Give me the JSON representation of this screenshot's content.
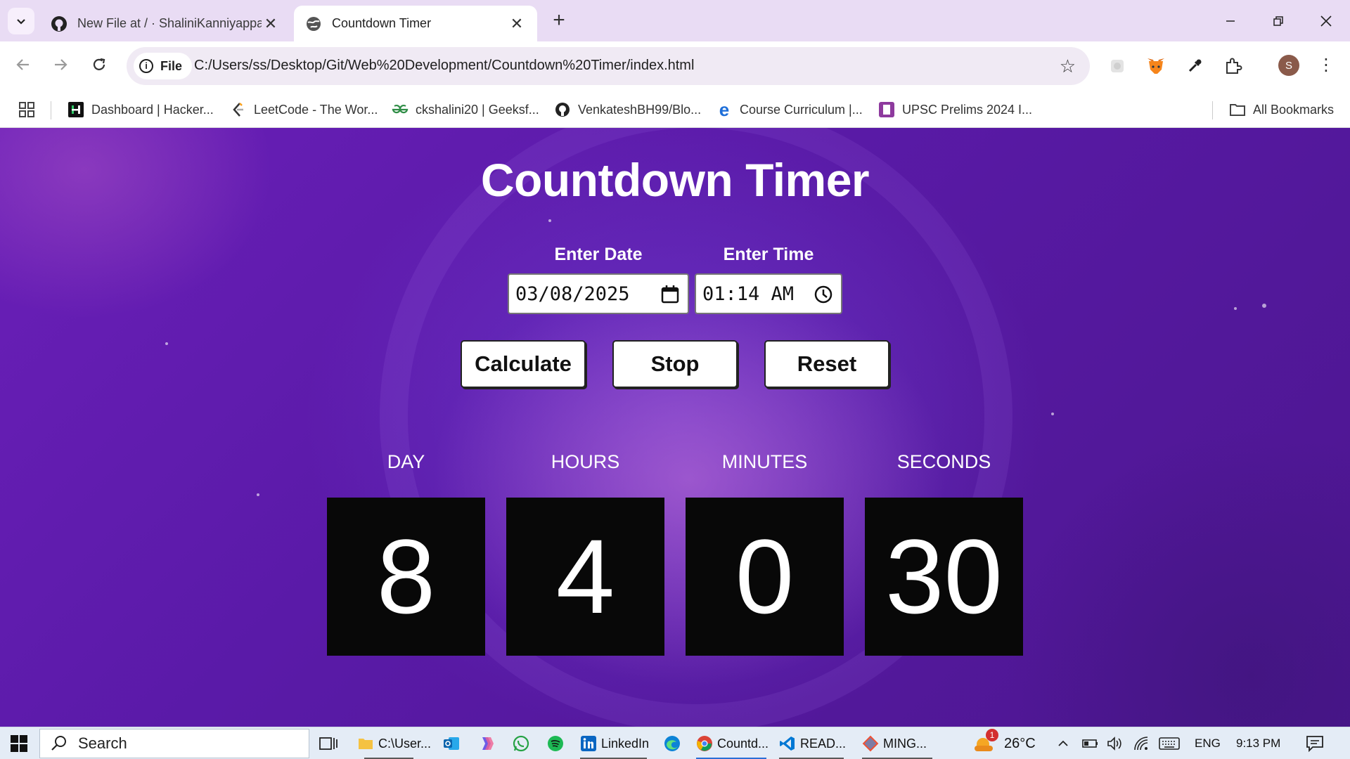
{
  "browser": {
    "tabs": [
      {
        "title": "New File at / · ShaliniKanniyappan",
        "icon": "github-icon",
        "active": false
      },
      {
        "title": "Countdown Timer",
        "icon": "globe-icon",
        "active": true
      }
    ],
    "new_tab_symbol": "+",
    "address": {
      "chip_label": "File",
      "url": "C:/Users/ss/Desktop/Git/Web%20Development/Countdown%20Timer/index.html"
    },
    "profile_initial": "S",
    "bookmarks": [
      {
        "label": "Dashboard | Hacker...",
        "icon": "hackerrank-icon"
      },
      {
        "label": "LeetCode - The Wor...",
        "icon": "leetcode-icon"
      },
      {
        "label": "ckshalini20 | Geeksf...",
        "icon": "geeksforgeeks-icon"
      },
      {
        "label": "VenkateshBH99/Blo...",
        "icon": "github-icon"
      },
      {
        "label": "Course Curriculum |...",
        "icon": "course-icon"
      },
      {
        "label": "UPSC Prelims 2024 I...",
        "icon": "upsc-icon"
      }
    ],
    "all_bookmarks_label": "All Bookmarks"
  },
  "app": {
    "title": "Countdown Timer",
    "date_label": "Enter Date",
    "date_value": "03/08/2025",
    "time_label": "Enter Time",
    "time_value": "01:14 AM",
    "buttons": {
      "calculate": "Calculate",
      "stop": "Stop",
      "reset": "Reset"
    },
    "units": [
      {
        "label": "DAY",
        "value": "8"
      },
      {
        "label": "HOURS",
        "value": "4"
      },
      {
        "label": "MINUTES",
        "value": "0"
      },
      {
        "label": "SECONDS",
        "value": "30"
      }
    ]
  },
  "taskbar": {
    "search_label": "Search",
    "items": [
      {
        "label": "C:\\User...",
        "icon": "file-explorer-icon"
      },
      {
        "label": "",
        "icon": "outlook-icon"
      },
      {
        "label": "",
        "icon": "copilot-icon"
      },
      {
        "label": "",
        "icon": "whatsapp-icon"
      },
      {
        "label": "",
        "icon": "spotify-icon"
      },
      {
        "label": "LinkedIn",
        "icon": "linkedin-icon"
      },
      {
        "label": "",
        "icon": "edge-icon"
      },
      {
        "label": "Countd...",
        "icon": "chrome-icon"
      },
      {
        "label": "READ...",
        "icon": "vscode-icon"
      },
      {
        "label": "MING...",
        "icon": "git-bash-icon"
      }
    ],
    "weather_badge": "1",
    "temperature": "26°C",
    "language": "ENG",
    "time": "9:13 PM"
  },
  "colors": {
    "accent_purple": "#6a1fb8",
    "digit_box_bg": "#080808",
    "chrome_bg": "#e9dcf4"
  }
}
